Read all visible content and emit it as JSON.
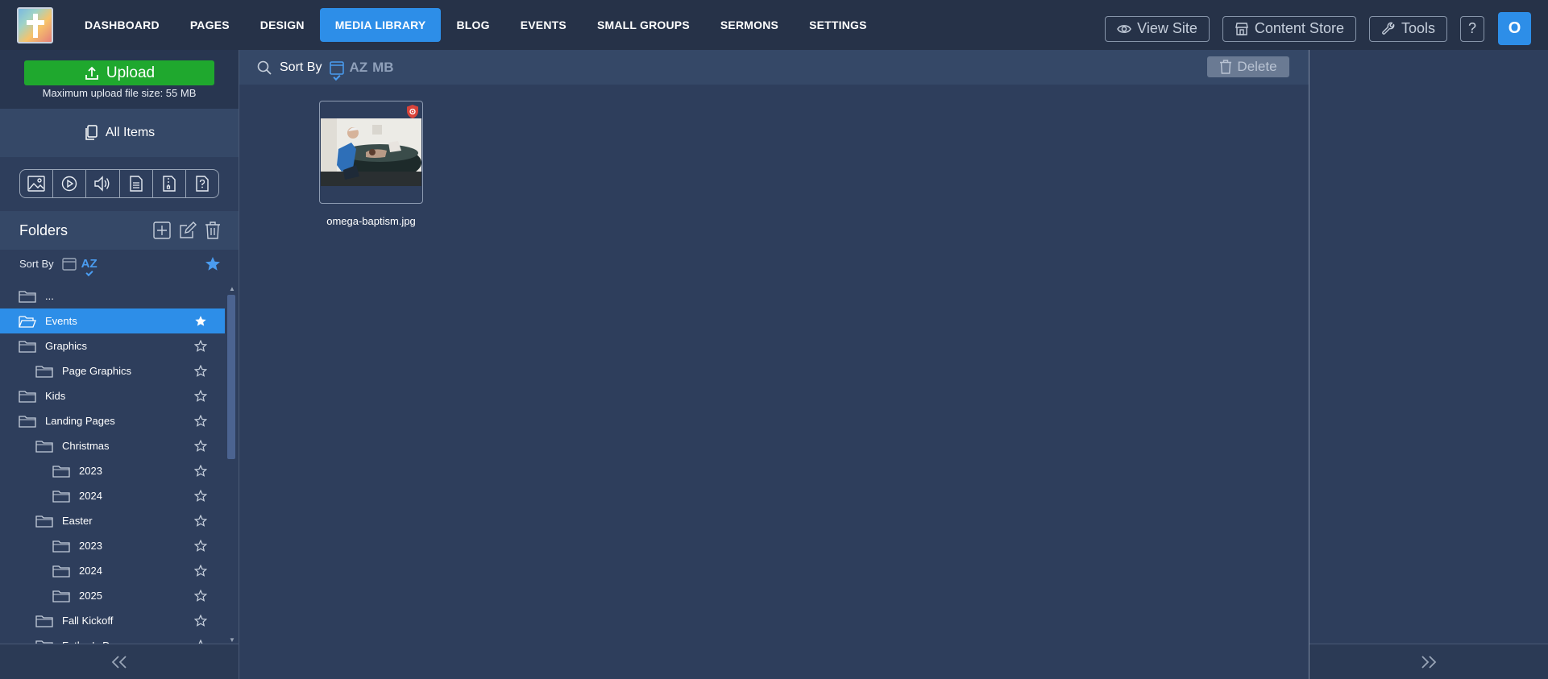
{
  "nav": {
    "items": [
      {
        "label": "DASHBOARD",
        "active": false
      },
      {
        "label": "PAGES",
        "active": false
      },
      {
        "label": "DESIGN",
        "active": false
      },
      {
        "label": "MEDIA LIBRARY",
        "active": true
      },
      {
        "label": "BLOG",
        "active": false
      },
      {
        "label": "EVENTS",
        "active": false
      },
      {
        "label": "SMALL GROUPS",
        "active": false
      },
      {
        "label": "SERMONS",
        "active": false
      },
      {
        "label": "SETTINGS",
        "active": false
      }
    ],
    "view_site": "View Site",
    "content_store": "Content Store",
    "tools": "Tools",
    "help": "?",
    "avatar_initial": "O"
  },
  "sidebar": {
    "upload_label": "Upload",
    "upload_note": "Maximum upload file size: 55 MB",
    "all_items": "All Items",
    "type_filters": [
      "image-filter-icon",
      "video-filter-icon",
      "audio-filter-icon",
      "document-filter-icon",
      "archive-filter-icon",
      "other-filter-icon"
    ],
    "folders_title": "Folders",
    "sort_label": "Sort By",
    "sort_az": "AZ",
    "tree": [
      {
        "name": "...",
        "depth": 0,
        "selected": false,
        "star": false
      },
      {
        "name": "Events",
        "depth": 0,
        "selected": true,
        "star": true
      },
      {
        "name": "Graphics",
        "depth": 0,
        "selected": false,
        "star": true
      },
      {
        "name": "Page Graphics",
        "depth": 1,
        "selected": false,
        "star": true
      },
      {
        "name": "Kids",
        "depth": 0,
        "selected": false,
        "star": true
      },
      {
        "name": "Landing Pages",
        "depth": 0,
        "selected": false,
        "star": true
      },
      {
        "name": "Christmas",
        "depth": 1,
        "selected": false,
        "star": true
      },
      {
        "name": "2023",
        "depth": 2,
        "selected": false,
        "star": true
      },
      {
        "name": "2024",
        "depth": 2,
        "selected": false,
        "star": true
      },
      {
        "name": "Easter",
        "depth": 1,
        "selected": false,
        "star": true
      },
      {
        "name": "2023",
        "depth": 2,
        "selected": false,
        "star": true
      },
      {
        "name": "2024",
        "depth": 2,
        "selected": false,
        "star": true
      },
      {
        "name": "2025",
        "depth": 2,
        "selected": false,
        "star": true
      },
      {
        "name": "Fall Kickoff",
        "depth": 1,
        "selected": false,
        "star": true
      },
      {
        "name": "Father's Day",
        "depth": 1,
        "selected": false,
        "star": true
      }
    ]
  },
  "main": {
    "sort_label": "Sort By",
    "sort_az": "AZ",
    "sort_mb": "MB",
    "delete_label": "Delete",
    "files": [
      {
        "name": "omega-baptism.jpg"
      }
    ]
  },
  "colors": {
    "accent": "#2d8ee8",
    "upload": "#1fa82e",
    "topbar": "#263248",
    "background": "#2e3e5c",
    "shield": "#d9433a"
  }
}
